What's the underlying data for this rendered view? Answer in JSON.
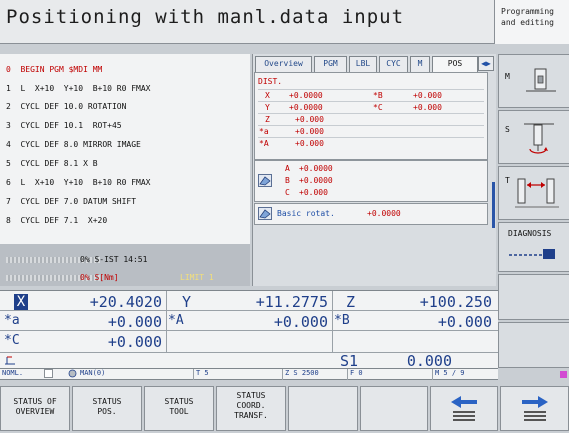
{
  "header": {
    "title": "Positioning with manl.data input",
    "mode_line1": "Programming",
    "mode_line2": "and editing"
  },
  "program": {
    "lines": [
      "0  BEGIN PGM $MDI MM",
      "1  L  X+10  Y+10  B+10 R0 FMAX",
      "2  CYCL DEF 10.0 ROTATION",
      "3  CYCL DEF 10.1  ROT+45",
      "4  CYCL DEF 8.0 MIRROR IMAGE",
      "5  CYCL DEF 8.1 X B",
      "6  L  X+10  Y+10  B+10 R0 FMAX",
      "7  CYCL DEF 7.0 DATUM SHIFT",
      "8  CYCL DEF 7.1  X+20"
    ],
    "active_index": 0,
    "override_text": "0% S-IST 14:51",
    "sist_text": "0% S[Nm]",
    "limit_text": "LIMIT 1"
  },
  "status": {
    "tabs": [
      "Overview",
      "PGM",
      "LBL",
      "CYC",
      "M",
      "POS"
    ],
    "active_tab": "POS",
    "dist_label": "DIST.",
    "dist_rows": [
      {
        "a": "X",
        "av": "+0.0000",
        "b": "*B",
        "bv": "+0.000"
      },
      {
        "a": "Y",
        "av": "+0.0000",
        "b": "*C",
        "bv": "+0.000"
      },
      {
        "a": "Z",
        "av": "+0.000",
        "b": "",
        "bv": ""
      },
      {
        "a": "*a",
        "av": "+0.000",
        "b": "",
        "bv": ""
      },
      {
        "a": "*A",
        "av": "+0.000",
        "b": "",
        "bv": ""
      }
    ],
    "tilt_rows": [
      {
        "a": "A",
        "v": "+0.0000"
      },
      {
        "a": "B",
        "v": "+0.0000"
      },
      {
        "a": "C",
        "v": "+0.000"
      }
    ],
    "basic_rot_label": "Basic rotat.",
    "basic_rot_value": "+0.0000"
  },
  "right_softkeys": {
    "m": "M",
    "s": "S",
    "t": "T",
    "diag": "DIAGNOSIS"
  },
  "positions": {
    "row1": [
      {
        "axis": "X",
        "val": "+20.4020"
      },
      {
        "axis": "Y",
        "val": "+11.2775"
      },
      {
        "axis": "Z",
        "val": "+100.250"
      }
    ],
    "row2": [
      {
        "axis": "*a",
        "val": "+0.000"
      },
      {
        "axis": "*A",
        "val": "+0.000"
      },
      {
        "axis": "*B",
        "val": "+0.000"
      }
    ],
    "row3": [
      {
        "axis": "*C",
        "val": "+0.000"
      }
    ],
    "spindle_label": "S1",
    "spindle_value": "0.000"
  },
  "infobar": {
    "noml": "NOML.",
    "man": "MAN(0)",
    "t": "T 5",
    "z": "Z S 2500",
    "f": "F 0",
    "m": "M 5 / 9"
  },
  "softkeys": [
    {
      "l1": "STATUS OF",
      "l2": "OVERVIEW",
      "l3": ""
    },
    {
      "l1": "STATUS",
      "l2": "POS.",
      "l3": ""
    },
    {
      "l1": "STATUS",
      "l2": "TOOL",
      "l3": ""
    },
    {
      "l1": "STATUS",
      "l2": "COORD.",
      "l3": "TRANSF."
    }
  ],
  "colors": {
    "accent_blue": "#1f3f8a",
    "active_red": "#c00000"
  }
}
